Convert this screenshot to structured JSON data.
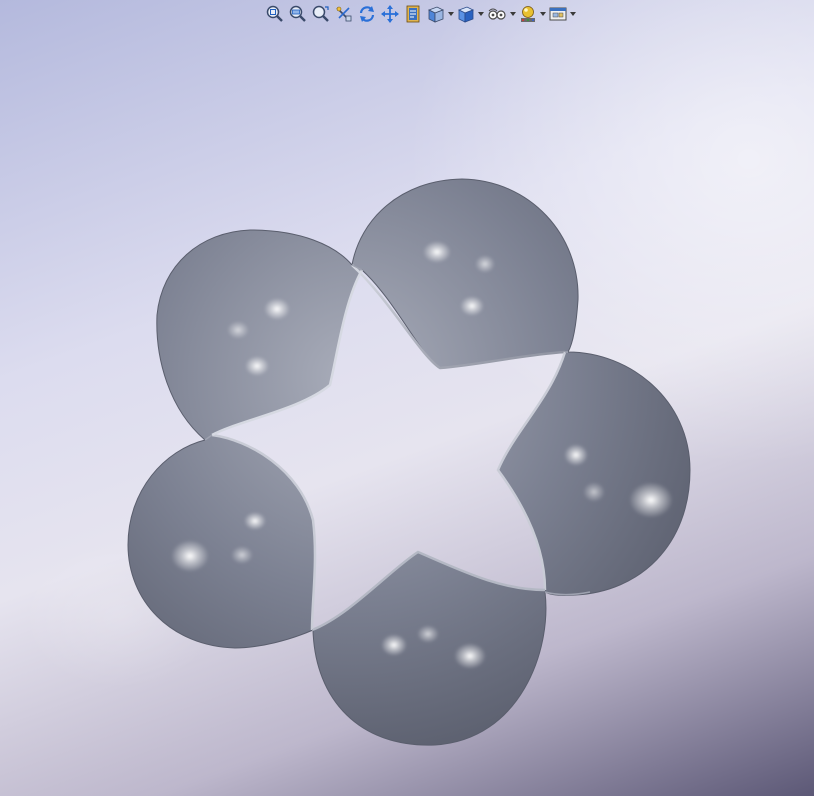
{
  "app": {
    "view": "graphics-area"
  },
  "toolbar": {
    "buttons": [
      {
        "name": "zoom-to-fit",
        "icon": "zoom-fit-icon",
        "has_dropdown": false
      },
      {
        "name": "zoom-to-area",
        "icon": "zoom-area-icon",
        "has_dropdown": false
      },
      {
        "name": "previous-view",
        "icon": "previous-view-icon",
        "has_dropdown": false
      },
      {
        "name": "section-view",
        "icon": "section-view-icon",
        "has_dropdown": false
      },
      {
        "name": "rotate-view",
        "icon": "rotate-icon",
        "has_dropdown": false
      },
      {
        "name": "pan-view",
        "icon": "pan-icon",
        "has_dropdown": false
      },
      {
        "name": "dynamic-annotation",
        "icon": "annotation-icon",
        "has_dropdown": false
      },
      {
        "name": "view-orientation",
        "icon": "view-orientation-icon",
        "has_dropdown": true
      },
      {
        "name": "display-style",
        "icon": "display-style-icon",
        "has_dropdown": true
      },
      {
        "name": "hide-show-items",
        "icon": "hide-show-icon",
        "has_dropdown": true
      },
      {
        "name": "edit-appearance",
        "icon": "appearance-icon",
        "has_dropdown": true
      },
      {
        "name": "view-settings",
        "icon": "view-settings-icon",
        "has_dropdown": true
      }
    ]
  },
  "model": {
    "shape": "five-lobed-twisted-band",
    "lobes": 5,
    "surface_color": "#7c8192"
  },
  "colors": {
    "bg_top": "#b4b9dd",
    "bg_bottom": "#5c5876",
    "surface_dark": "#5a5e6d",
    "surface_mid": "#7c8192",
    "surface_light": "#a9adba"
  }
}
